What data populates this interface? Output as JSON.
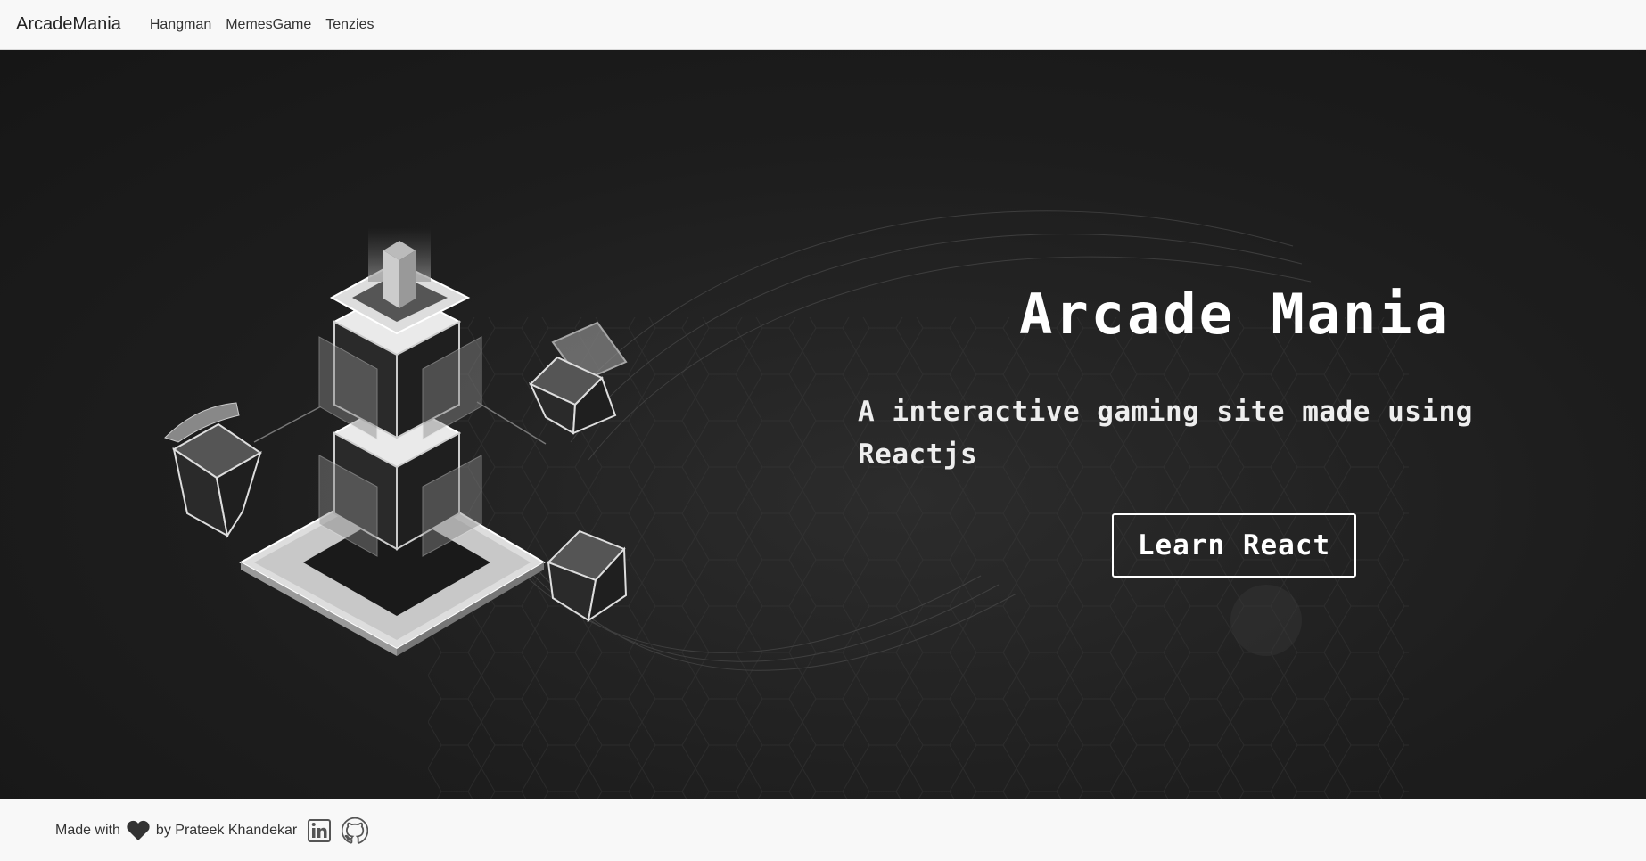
{
  "navbar": {
    "brand": "ArcadeMania",
    "links": [
      {
        "label": "Hangman"
      },
      {
        "label": "MemesGame"
      },
      {
        "label": "Tenzies"
      }
    ]
  },
  "hero": {
    "title": "Arcade Mania",
    "subtitle": "A interactive gaming site made using Reactjs",
    "button_label": "Learn React"
  },
  "footer": {
    "made_with": "Made with",
    "heart_icon": "heart-icon",
    "by_text": "by Prateek Khandekar",
    "linkedin_icon": "linkedin-icon",
    "github_icon": "github-icon"
  },
  "colors": {
    "hero_background": "#1d1d1d",
    "navbar_background": "#f8f8f8",
    "text_on_dark": "#ffffff"
  }
}
